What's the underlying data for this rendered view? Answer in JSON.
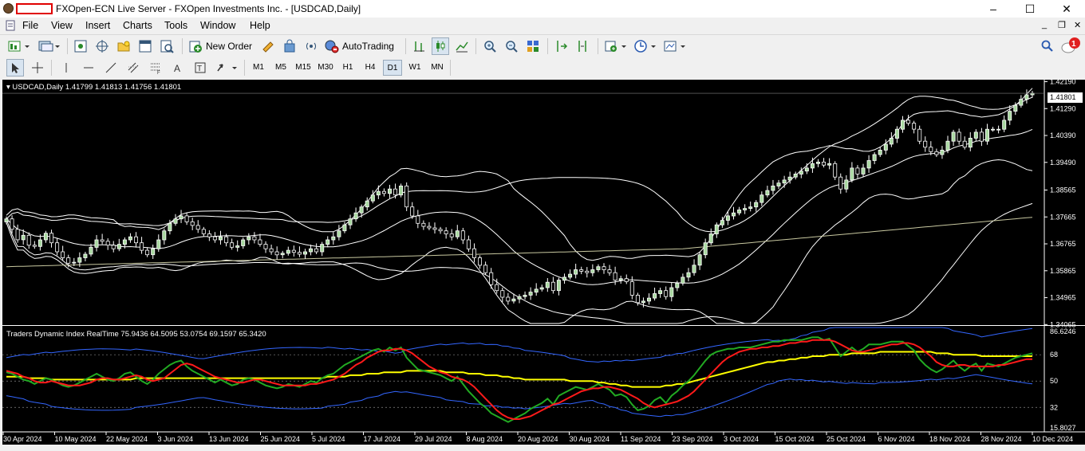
{
  "window": {
    "title": "FXOpen-ECN Live Server - FXOpen Investments Inc. - [USDCAD,Daily]",
    "controls": [
      "–",
      "☐",
      "✕"
    ]
  },
  "menu": {
    "items": [
      "File",
      "View",
      "Insert",
      "Charts",
      "Tools",
      "Window",
      "Help"
    ],
    "mdi_controls": [
      "_",
      "❐",
      "✕"
    ]
  },
  "toolbar": {
    "new_order_label": "New Order",
    "autotrading_label": "AutoTrading",
    "notification_count": "1"
  },
  "timeframes": {
    "items": [
      "M1",
      "M5",
      "M15",
      "M30",
      "H1",
      "H4",
      "D1",
      "W1",
      "MN"
    ],
    "active": "D1"
  },
  "colors": {
    "bull_candle": "#ffffff",
    "bear_candle": "#000000",
    "bull_fill": "#a8d8a0",
    "bollinger": "#ffffff",
    "ma_long": "#c8c8a0",
    "tdi_rsi": "#22aa22",
    "tdi_signal": "#ff1a1a",
    "tdi_mbl": "#ffff00",
    "tdi_bands": "#3366ff"
  },
  "main_chart": {
    "label": "USDCAD,Daily  1.41799 1.41813 1.41756 1.41801",
    "current_price": "1.41801",
    "price_axis": [
      "1.42190",
      "1.41290",
      "1.40390",
      "1.39490",
      "1.38565",
      "1.37665",
      "1.36765",
      "1.35865",
      "1.34965",
      "1.34065"
    ]
  },
  "indicator": {
    "label": "Traders Dynamic Index RealTime 75.9436 64.5095 53.0754 69.1597 65.3420",
    "axis": [
      "86.6246",
      "68",
      "50",
      "32",
      "15.8027"
    ]
  },
  "time_axis": [
    "30 Apr 2024",
    "10 May 2024",
    "22 May 2024",
    "3 Jun 2024",
    "13 Jun 2024",
    "25 Jun 2024",
    "5 Jul 2024",
    "17 Jul 2024",
    "29 Jul 2024",
    "8 Aug 2024",
    "20 Aug 2024",
    "30 Aug 2024",
    "11 Sep 2024",
    "23 Sep 2024",
    "3 Oct 2024",
    "15 Oct 2024",
    "25 Oct 2024",
    "6 Nov 2024",
    "18 Nov 2024",
    "28 Nov 2024",
    "10 Dec 2024"
  ],
  "chart_data": {
    "type": "candlestick",
    "symbol": "USDCAD",
    "timeframe": "Daily",
    "y_range": [
      1.341,
      1.4223
    ],
    "closes": [
      1.376,
      1.3725,
      1.369,
      1.3705,
      1.3672,
      1.3668,
      1.369,
      1.3712,
      1.368,
      1.365,
      1.363,
      1.3612,
      1.3615,
      1.363,
      1.3642,
      1.3665,
      1.369,
      1.3685,
      1.3672,
      1.366,
      1.3675,
      1.369,
      1.37,
      1.368,
      1.3655,
      1.364,
      1.366,
      1.369,
      1.372,
      1.3745,
      1.376,
      1.377,
      1.375,
      1.3738,
      1.3725,
      1.371,
      1.37,
      1.369,
      1.37,
      1.368,
      1.3665,
      1.367,
      1.369,
      1.37,
      1.369,
      1.3675,
      1.366,
      1.365,
      1.364,
      1.3645,
      1.3655,
      1.3648,
      1.3642,
      1.365,
      1.366,
      1.365,
      1.3675,
      1.369,
      1.37,
      1.372,
      1.374,
      1.376,
      1.378,
      1.38,
      1.382,
      1.384,
      1.3852,
      1.3845,
      1.386,
      1.384,
      1.387,
      1.38,
      1.377,
      1.3745,
      1.3735,
      1.373,
      1.3725,
      1.372,
      1.371,
      1.37,
      1.372,
      1.369,
      1.366,
      1.363,
      1.3605,
      1.358,
      1.354,
      1.352,
      1.3498,
      1.3485,
      1.3492,
      1.35,
      1.3505,
      1.3515,
      1.3525,
      1.353,
      1.3548,
      1.352,
      1.3555,
      1.3565,
      1.3575,
      1.359,
      1.3585,
      1.358,
      1.359,
      1.36,
      1.359,
      1.358,
      1.3555,
      1.356,
      1.355,
      1.3505,
      1.348,
      1.3485,
      1.3495,
      1.351,
      1.352,
      1.35,
      1.353,
      1.3545,
      1.3565,
      1.358,
      1.3605,
      1.364,
      1.368,
      1.371,
      1.374,
      1.3755,
      1.377,
      1.378,
      1.379,
      1.3795,
      1.38,
      1.3815,
      1.384,
      1.3855,
      1.387,
      1.388,
      1.389,
      1.39,
      1.391,
      1.392,
      1.393,
      1.3945,
      1.395,
      1.394,
      1.3945,
      1.39,
      1.386,
      1.389,
      1.393,
      1.391,
      1.393,
      1.3955,
      1.3975,
      1.399,
      1.401,
      1.403,
      1.406,
      1.409,
      1.408,
      1.406,
      1.402,
      1.4,
      1.3985,
      1.3975,
      1.399,
      1.402,
      1.405,
      1.402,
      1.4,
      1.403,
      1.405,
      1.402,
      1.406,
      1.406,
      1.406,
      1.409,
      1.412,
      1.414,
      1.416,
      1.4175,
      1.418
    ],
    "tdi": {
      "rsi": [
        56,
        55,
        53,
        51,
        50,
        48,
        50,
        52,
        51,
        49,
        47,
        46,
        47,
        49,
        51,
        53,
        55,
        53,
        51,
        50,
        52,
        55,
        56,
        53,
        50,
        48,
        51,
        55,
        58,
        61,
        63,
        64,
        60,
        57,
        55,
        53,
        51,
        49,
        51,
        49,
        47,
        48,
        51,
        52,
        51,
        49,
        47,
        46,
        45,
        46,
        48,
        47,
        46,
        48,
        50,
        49,
        52,
        54,
        55,
        58,
        61,
        63,
        65,
        67,
        69,
        71,
        72,
        70,
        73,
        71,
        73,
        66,
        62,
        58,
        57,
        56,
        55,
        54,
        52,
        50,
        53,
        48,
        43,
        39,
        35,
        32,
        28,
        26,
        24,
        22,
        24,
        26,
        28,
        31,
        33,
        35,
        38,
        34,
        40,
        42,
        44,
        46,
        45,
        44,
        46,
        48,
        46,
        44,
        40,
        41,
        39,
        34,
        30,
        31,
        33,
        37,
        39,
        35,
        40,
        43,
        47,
        50,
        54,
        59,
        64,
        68,
        70,
        71,
        72,
        72,
        73,
        73,
        73,
        74,
        75,
        76,
        77,
        77,
        78,
        78,
        78,
        78,
        79,
        80,
        80,
        78,
        79,
        73,
        67,
        70,
        73,
        70,
        72,
        75,
        75,
        75,
        76,
        77,
        77,
        77,
        74,
        71,
        65,
        61,
        58,
        56,
        58,
        61,
        64,
        60,
        57,
        60,
        62,
        57,
        62,
        61,
        60,
        62,
        64,
        66,
        67,
        68,
        69
      ],
      "signal": [
        57,
        56,
        55,
        53,
        52,
        50,
        49,
        49,
        50,
        49,
        48,
        47,
        47,
        47,
        48,
        49,
        51,
        52,
        52,
        51,
        51,
        52,
        53,
        54,
        53,
        51,
        50,
        51,
        52,
        55,
        58,
        61,
        62,
        61,
        59,
        57,
        55,
        53,
        52,
        51,
        50,
        49,
        49,
        50,
        51,
        51,
        50,
        49,
        48,
        47,
        47,
        47,
        47,
        47,
        48,
        48,
        49,
        50,
        51,
        53,
        55,
        58,
        61,
        63,
        66,
        68,
        70,
        71,
        71,
        72,
        72,
        71,
        69,
        66,
        63,
        60,
        58,
        56,
        55,
        53,
        52,
        51,
        49,
        46,
        42,
        38,
        34,
        30,
        27,
        25,
        24,
        24,
        25,
        26,
        28,
        30,
        32,
        34,
        35,
        37,
        39,
        41,
        43,
        44,
        45,
        45,
        46,
        46,
        45,
        44,
        42,
        40,
        38,
        35,
        33,
        32,
        33,
        34,
        35,
        36,
        38,
        40,
        43,
        47,
        51,
        55,
        59,
        63,
        66,
        68,
        70,
        71,
        72,
        72,
        73,
        73,
        74,
        74,
        75,
        76,
        76,
        77,
        77,
        78,
        78,
        78,
        78,
        77,
        75,
        73,
        71,
        70,
        70,
        71,
        72,
        73,
        74,
        75,
        75,
        76,
        76,
        75,
        73,
        70,
        67,
        63,
        61,
        60,
        60,
        61,
        61,
        60,
        60,
        60,
        60,
        60,
        61,
        61,
        62,
        63,
        64,
        65,
        65
      ],
      "mbl": [
        53,
        53,
        53,
        53,
        52,
        52,
        52,
        52,
        51,
        51,
        51,
        51,
        51,
        51,
        51,
        51,
        51,
        51,
        51,
        51,
        51,
        51,
        51,
        52,
        52,
        52,
        52,
        52,
        52,
        52,
        52,
        52,
        52,
        52,
        52,
        52,
        52,
        52,
        52,
        52,
        52,
        52,
        52,
        52,
        52,
        52,
        52,
        52,
        52,
        52,
        52,
        52,
        52,
        52,
        52,
        52,
        52,
        53,
        53,
        53,
        53,
        54,
        54,
        54,
        55,
        55,
        55,
        56,
        56,
        56,
        56,
        57,
        57,
        57,
        57,
        57,
        57,
        57,
        56,
        56,
        56,
        56,
        55,
        55,
        55,
        54,
        54,
        54,
        53,
        53,
        52,
        52,
        51,
        51,
        51,
        51,
        51,
        51,
        51,
        51,
        50,
        50,
        50,
        50,
        50,
        49,
        49,
        48,
        48,
        47,
        47,
        46,
        46,
        46,
        46,
        46,
        46,
        47,
        47,
        48,
        48,
        49,
        50,
        51,
        52,
        53,
        54,
        55,
        56,
        57,
        58,
        59,
        60,
        61,
        62,
        63,
        63,
        64,
        64,
        65,
        65,
        66,
        66,
        67,
        67,
        67,
        68,
        68,
        68,
        68,
        69,
        69,
        69,
        69,
        69,
        70,
        70,
        70,
        70,
        70,
        70,
        70,
        70,
        70,
        70,
        69,
        69,
        69,
        68,
        68,
        68,
        68,
        68,
        67,
        67,
        67,
        67,
        67,
        67,
        67,
        67,
        67,
        67
      ]
    },
    "bands": {
      "upper_pct": [
        0.52,
        0.57,
        0.35,
        0.55
      ],
      "lower_pct": [
        0.12,
        0.21,
        0.35,
        0.22
      ]
    }
  }
}
